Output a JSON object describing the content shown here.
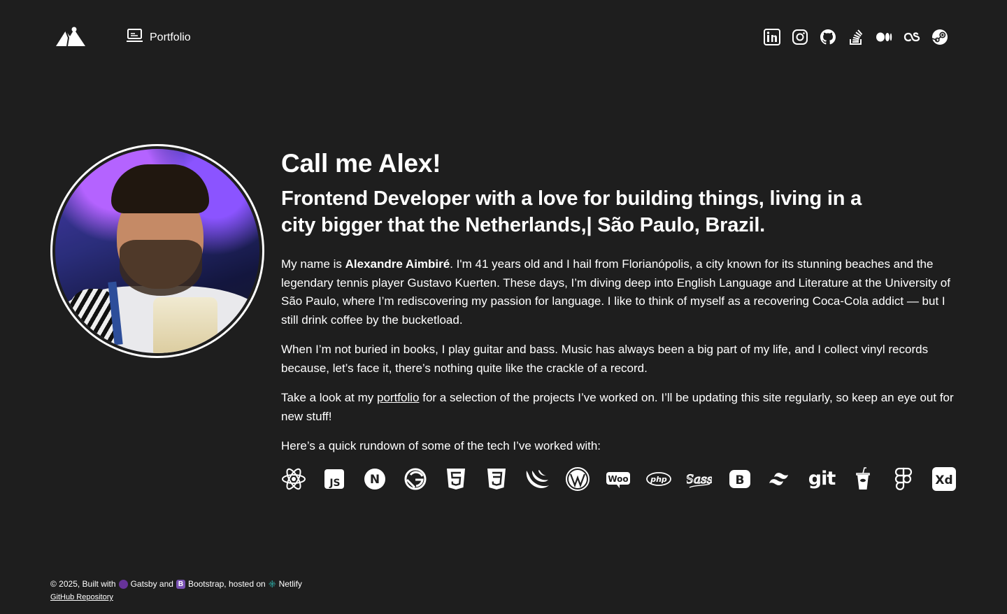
{
  "header": {
    "logo_icon": "mountain-logo-icon",
    "nav": {
      "portfolio_label": "Portfolio",
      "portfolio_icon": "laptop-icon"
    },
    "socials": [
      {
        "name": "linkedin-icon"
      },
      {
        "name": "instagram-icon"
      },
      {
        "name": "github-icon"
      },
      {
        "name": "stackoverflow-icon"
      },
      {
        "name": "medium-icon"
      },
      {
        "name": "lastfm-icon"
      },
      {
        "name": "steam-icon"
      }
    ]
  },
  "hero": {
    "title": "Call me Alex!",
    "subtitle": "Frontend Developer with a love for building things, living in a city bigger that the Netherlands,| São Paulo, Brazil.",
    "p1_before": "My name is ",
    "p1_name": "Alexandre Aimbiré",
    "p1_after": ". I'm 41 years old and I hail from Florianópolis, a city known for its stunning beaches and the legendary tennis player Gustavo Kuerten. These days, I’m diving deep into English Language and Literature at the University of São Paulo, where I’m rediscovering my passion for language. I like to think of myself as a recovering Coca-Cola addict — but I still drink coffee by the bucketload.",
    "p2": "When I’m not buried in books, I play guitar and bass. Music has always been a big part of my life, and I collect vinyl records because, let’s face it, there’s nothing quite like the crackle of a record.",
    "p3_before": "Take a look at my ",
    "p3_link": "portfolio",
    "p3_after": " for a selection of the projects I’ve worked on. I’ll be updating this site regularly, so keep an eye out for new stuff!",
    "p4": "Here’s a quick rundown of some of the tech I’ve worked with:",
    "tech": [
      "react-icon",
      "javascript-icon",
      "nextjs-icon",
      "gatsby-icon",
      "html5-icon",
      "css3-icon",
      "jquery-icon",
      "wordpress-icon",
      "woocommerce-icon",
      "php-icon",
      "sass-icon",
      "bootstrap-icon",
      "tailwind-icon",
      "git-icon",
      "gulp-icon",
      "figma-icon",
      "adobe-xd-icon"
    ],
    "tech_text": {
      "js": "JS",
      "woo": "Woo",
      "php": "php",
      "sass": "Sass",
      "bootstrap": "B",
      "git": "git",
      "xd": "Xd",
      "nextjs": "N"
    }
  },
  "footer": {
    "built_prefix": "© 2025, Built with",
    "gatsby": "Gatsby and",
    "bootstrap_badge": "B",
    "bootstrap": "Bootstrap, hosted on",
    "netlify": "Netlify",
    "repo_link": "GitHub Repository"
  }
}
